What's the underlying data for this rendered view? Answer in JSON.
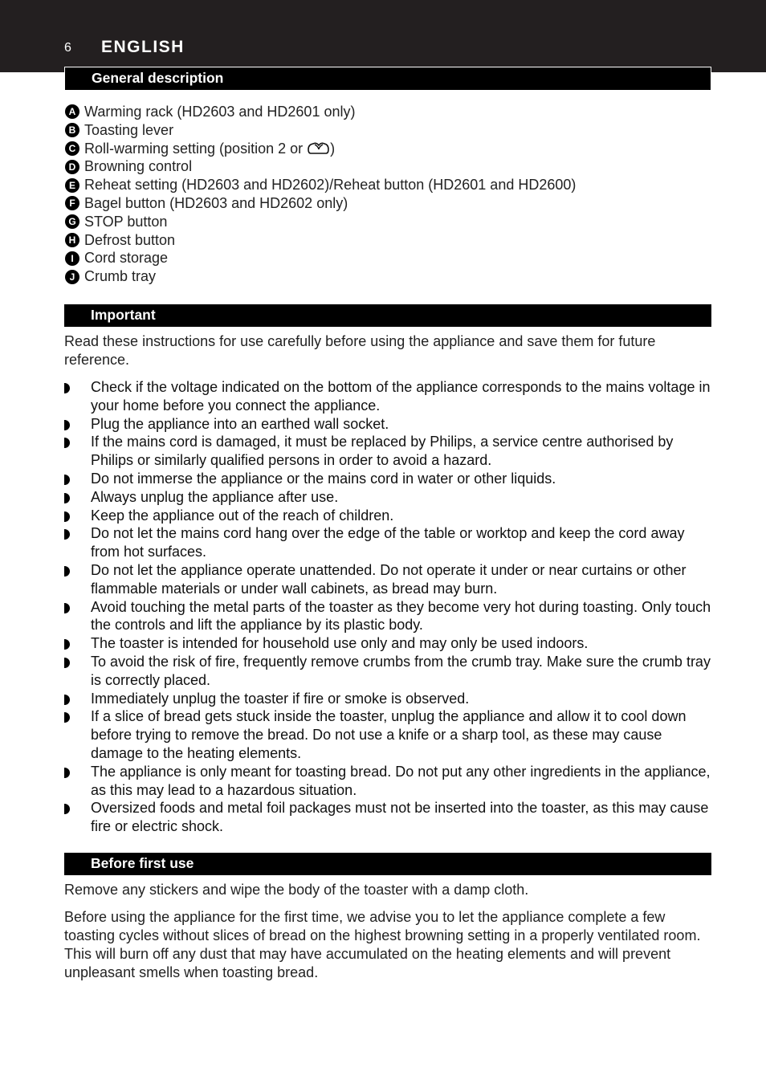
{
  "header": {
    "page_number": "6",
    "language": "ENGLISH",
    "band_color": "#231f20"
  },
  "sections": {
    "general_description": {
      "title": "General description",
      "parts": [
        {
          "letter": "A",
          "text": "Warming rack (HD2603 and HD2601 only)"
        },
        {
          "letter": "B",
          "text": "Toasting lever"
        },
        {
          "letter": "C",
          "text_before_icon": "Roll-warming setting (position 2 or ",
          "icon": "roll-warming-icon",
          "text_after_icon": ")"
        },
        {
          "letter": "D",
          "text": "Browning control"
        },
        {
          "letter": "E",
          "text": "Reheat setting (HD2603 and HD2602)/Reheat button (HD2601 and HD2600)"
        },
        {
          "letter": "F",
          "text": "Bagel button (HD2603 and HD2602 only)"
        },
        {
          "letter": "G",
          "text": "STOP button"
        },
        {
          "letter": "H",
          "text": "Defrost button"
        },
        {
          "letter": "I",
          "text": "Cord storage"
        },
        {
          "letter": "J",
          "text": "Crumb tray"
        }
      ]
    },
    "important": {
      "title": "Important",
      "intro": "Read these instructions for use carefully before using the appliance and save them for future reference.",
      "bullets": [
        "Check if the voltage indicated on the bottom of the appliance corresponds to the mains voltage in your home before you connect the appliance.",
        "Plug the appliance into an earthed wall socket.",
        "If the mains cord is damaged, it must be replaced by Philips, a service centre authorised by Philips or similarly qualified persons in order to avoid a hazard.",
        "Do not immerse the appliance or the mains cord in water or other liquids.",
        "Always unplug the appliance after use.",
        "Keep the appliance out of the reach of children.",
        "Do not let the mains cord hang over the edge of the table or worktop and keep the cord away from hot surfaces.",
        "Do not let the appliance operate unattended. Do not operate it under or near curtains or other flammable materials or under wall cabinets, as bread may burn.",
        "Avoid touching the metal parts of the toaster as they become very hot during toasting. Only touch the controls and lift the appliance by its plastic body.",
        "The toaster is intended for household use only and may only be used indoors.",
        "To avoid the risk of fire, frequently remove crumbs from the crumb tray. Make sure the crumb tray is correctly placed.",
        "Immediately unplug the toaster if fire or smoke is observed.",
        "If a slice of bread gets stuck inside the toaster, unplug the appliance and allow it to cool down before trying to remove the bread. Do not use a knife or a sharp tool, as these may cause damage to the heating elements.",
        "The appliance is only meant for toasting bread. Do not put any other ingredients in the appliance, as this may lead to a hazardous situation.",
        "Oversized foods and metal foil packages must not be inserted into the toaster, as this may cause fire or electric shock."
      ]
    },
    "before_first_use": {
      "title": "Before first use",
      "paragraphs": [
        "Remove any stickers and wipe the body of the toaster with a damp cloth.",
        "Before using the appliance for the first time, we advise you to let the appliance complete a few toasting cycles without slices of bread on the highest browning setting in a properly ventilated room. This will burn off any dust that may have accumulated on the heating elements and will prevent unpleasant smells when toasting bread."
      ]
    }
  }
}
